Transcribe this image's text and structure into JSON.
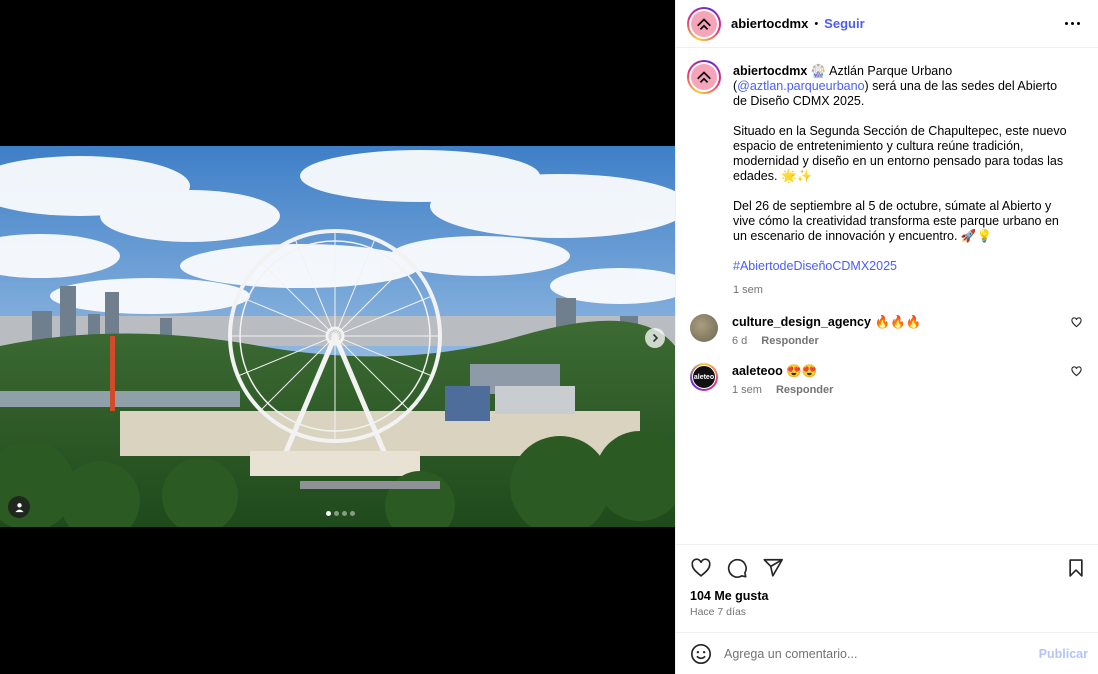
{
  "post": {
    "author": "abiertocdmx",
    "header_separator": "•",
    "follow_label": "Seguir",
    "media": {
      "slide_count": 4,
      "active_slide": 1
    },
    "caption": {
      "username": "abiertocdmx",
      "line1_text": " 🎡 Aztlán Parque Urbano (",
      "mention": "@aztlan.parqueurbano",
      "line1_rest": ") será una de las sedes del Abierto de Diseño CDMX 2025.",
      "paragraph2": "Situado en la Segunda Sección de Chapultepec, este nuevo espacio de entretenimiento y cultura reúne tradición, modernidad y diseño en un entorno pensado para todas las edades. 🌟✨",
      "paragraph3": "Del 26 de septiembre al 5 de octubre, súmate al Abierto y vive cómo la creatividad transforma este parque urbano en un escenario de innovación y encuentro. 🚀💡",
      "hashtag": "#AbiertodeDiseñoCDMX2025",
      "time": "1 sem"
    },
    "comments": [
      {
        "username": "culture_design_agency",
        "text": "🔥🔥🔥",
        "time": "6 d",
        "reply_label": "Responder"
      },
      {
        "username": "aaleteoo",
        "text": "😍😍",
        "time": "1 sem",
        "reply_label": "Responder",
        "avatar_text": "aleteo"
      }
    ],
    "likes": "104 Me gusta",
    "date": "Hace 7 días",
    "comment_input": {
      "placeholder": "Agrega un comentario...",
      "publish_label": "Publicar"
    }
  },
  "icons": {
    "like": "heart-icon",
    "comment": "comment-bubble-icon",
    "share": "paper-plane-icon",
    "save": "bookmark-icon",
    "emoji": "smiley-icon",
    "more": "more-options-icon",
    "next": "chevron-right-icon",
    "tag": "person-tag-icon"
  },
  "colors": {
    "link": "#4a5df9",
    "muted": "#737373",
    "publish_disabled": "#b1c5f9",
    "avatar_pink": "#f6a5b8"
  }
}
